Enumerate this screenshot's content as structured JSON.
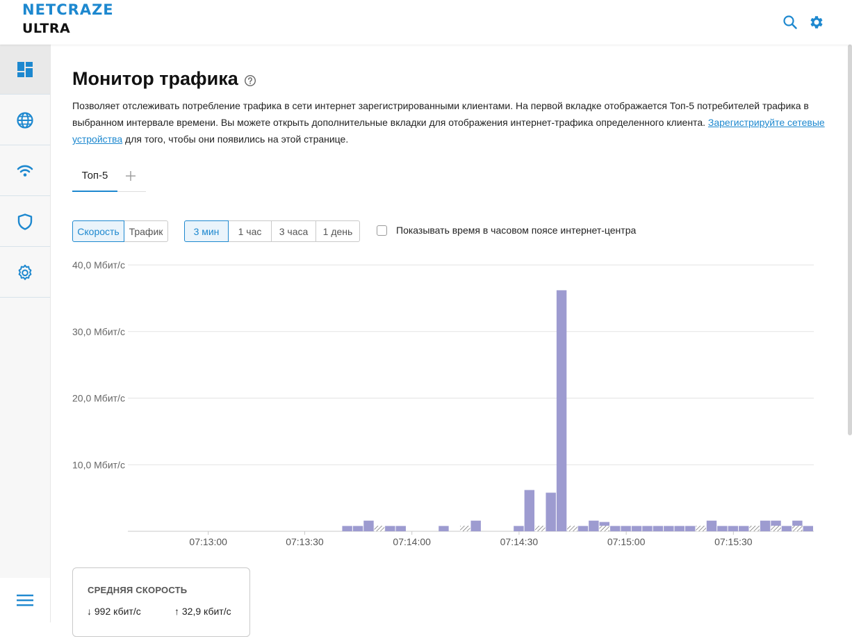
{
  "app": {
    "logo_top": "NETCRAZE",
    "logo_bottom": "ULTRA",
    "brand_color": "#1d88cf"
  },
  "header": {
    "search_icon": "search-icon",
    "settings_icon": "gear-icon"
  },
  "sidebar": {
    "items": [
      {
        "icon": "dashboard-icon",
        "active": true
      },
      {
        "icon": "globe-icon"
      },
      {
        "icon": "wifi-icon"
      },
      {
        "icon": "shield-icon"
      },
      {
        "icon": "gear-icon"
      }
    ],
    "menu_icon": "hamburger-icon"
  },
  "page": {
    "title": "Монитор трафика",
    "desc_part1": "Позволяет отслеживать потребление трафика в сети интернет зарегистрированными клиентами. На первой вкладке отображается Топ-5 потребителей трафика в выбранном интервале времени. Вы можете открыть дополнительные вкладки для отображения интернет-трафика определенного клиента. ",
    "desc_link": "Зарегистрируйте сетевые устройства",
    "desc_part2": " для того, чтобы они появились на этой странице."
  },
  "tabs": {
    "items": [
      "Топ-5"
    ],
    "active": 0
  },
  "mode_toggle": {
    "options": [
      "Скорость",
      "Трафик"
    ],
    "selected": "Скорость"
  },
  "range_toggle": {
    "options": [
      "3 мин",
      "1 час",
      "3 часа",
      "1 день"
    ],
    "selected": "3 мин"
  },
  "timezone_checkbox": {
    "label": "Показывать время в часовом поясе интернет-центра",
    "checked": false
  },
  "chart_data": {
    "type": "bar",
    "bar_color": "#9d9bd0",
    "ylim": [
      0,
      40
    ],
    "y_ticks": [
      "40,0 Мбит/с",
      "30,0 Мбит/с",
      "20,0 Мбит/с",
      "10,0 Мбит/с"
    ],
    "y_tick_values": [
      40,
      30,
      20,
      10
    ],
    "x_ticks": [
      "07:13:00",
      "07:13:30",
      "07:14:00",
      "07:14:30",
      "07:15:00",
      "07:15:30"
    ],
    "x_tick_bar_index": [
      7,
      16,
      26,
      36,
      46,
      56
    ],
    "values": [
      0,
      0,
      0,
      0,
      0,
      0,
      0,
      0,
      0,
      0,
      0,
      0,
      0,
      0,
      0,
      0,
      0,
      0,
      0,
      0,
      0.8,
      0.8,
      1.6,
      0.8,
      0.8,
      0.8,
      0,
      0,
      0,
      0.8,
      0,
      0,
      1.6,
      0,
      0,
      0,
      0.8,
      6.2,
      0.8,
      5.8,
      36.2,
      0.8,
      0.8,
      1.6,
      1.4,
      0.8,
      0.8,
      0.8,
      0.8,
      0.8,
      0.8,
      0.8,
      0.8,
      0.8,
      1.6,
      0.8,
      0.8,
      0.8,
      0.8,
      1.6,
      1.6,
      0.8,
      1.6,
      0.8
    ],
    "hatched": [
      23,
      31,
      38,
      41,
      44,
      53,
      58,
      60,
      62
    ],
    "grid": true
  },
  "stats": {
    "title": "СРЕДНЯЯ СКОРОСТЬ",
    "down": "↓ 992 кбит/с",
    "up": "↑ 32,9 кбит/с"
  }
}
